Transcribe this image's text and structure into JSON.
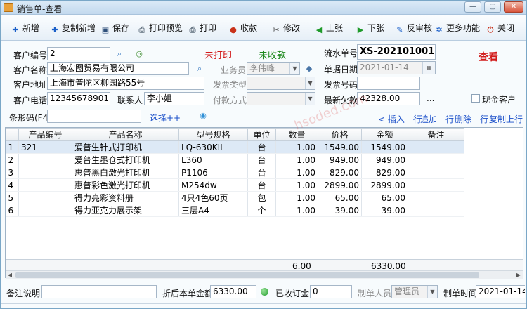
{
  "window": {
    "title": "销售单-查看",
    "btn_min": "—",
    "btn_max": "▢",
    "btn_close": "✕"
  },
  "toolbar": {
    "new": "新增",
    "copy_new": "复制新增",
    "save": "保存",
    "print_preview": "打印预览",
    "print": "打印",
    "collect": "收款",
    "edit": "修改",
    "prev": "上张",
    "next": "下张",
    "reverse_audit": "反审核",
    "more": "更多功能",
    "close": "关闭"
  },
  "form": {
    "customer_no_label": "客户编号",
    "customer_no": "2",
    "print_status": "未打印",
    "pay_status": "未收款",
    "serial_label": "流水单号",
    "serial": "XS-202101001",
    "view_mode": "查看",
    "customer_name_label": "客户名称",
    "customer_name": "上海宏图贸易有限公司",
    "salesman_label": "业务员",
    "salesman": "李伟峰",
    "date_label": "单据日期",
    "date": "2021-01-14",
    "address_label": "客户地址",
    "address": "上海市普陀区柳园路55号",
    "invoice_type_label": "发票类型",
    "invoice_type": "",
    "invoice_no_label": "发票号码",
    "invoice_no": "",
    "phone_label": "客户电话",
    "phone": "12345678901",
    "contact_label": "联系人",
    "contact": "李小姐",
    "pay_method_label": "付款方式",
    "pay_method": "",
    "latest_debt_label": "最新欠款",
    "latest_debt": "42328.00",
    "ellipsis": "...",
    "cash_customer_label": "现金客户"
  },
  "barcode": {
    "label": "条形码(F4)",
    "value": "",
    "select": "选择++",
    "insert_row": "< 插入一行",
    "append_row": "追加一行",
    "delete_row": "删除一行",
    "copy_row": "复制上行"
  },
  "grid": {
    "headers": [
      "",
      "产品编号",
      "产品名称",
      "型号规格",
      "单位",
      "数量",
      "价格",
      "金额",
      "备注"
    ],
    "rows": [
      [
        "1",
        "321",
        "爱普生针式打印机",
        "LQ-630KII",
        "台",
        "1.00",
        "1549.00",
        "1549.00",
        ""
      ],
      [
        "2",
        "",
        "爱普生墨仓式打印机",
        "L360",
        "台",
        "1.00",
        "949.00",
        "949.00",
        ""
      ],
      [
        "3",
        "",
        "惠普黑白激光打印机",
        "P1106",
        "台",
        "1.00",
        "829.00",
        "829.00",
        ""
      ],
      [
        "4",
        "",
        "惠普彩色激光打印机",
        "M254dw",
        "台",
        "1.00",
        "2899.00",
        "2899.00",
        ""
      ],
      [
        "5",
        "",
        "得力亮彩资料册",
        "4只4色60页",
        "包",
        "1.00",
        "65.00",
        "65.00",
        ""
      ],
      [
        "6",
        "",
        "得力亚克力展示架",
        "三层A4",
        "个",
        "1.00",
        "39.00",
        "39.00",
        ""
      ]
    ],
    "total_qty": "6.00",
    "total_amount": "6330.00"
  },
  "footer": {
    "remark_label": "备注说明",
    "remark": "",
    "discount_label": "折后本单金额",
    "discount_amount": "6330.00",
    "deposit_label": "已收订金",
    "deposit": "0",
    "maker_label": "制单人员",
    "maker": "管理员",
    "make_time_label": "制单时间",
    "make_time": "2021-01-14 09"
  },
  "watermark": "hsoded.com",
  "colors": {
    "red": "#d21a1a",
    "green": "#1f8a1f",
    "blue": "#1a4fc9"
  }
}
